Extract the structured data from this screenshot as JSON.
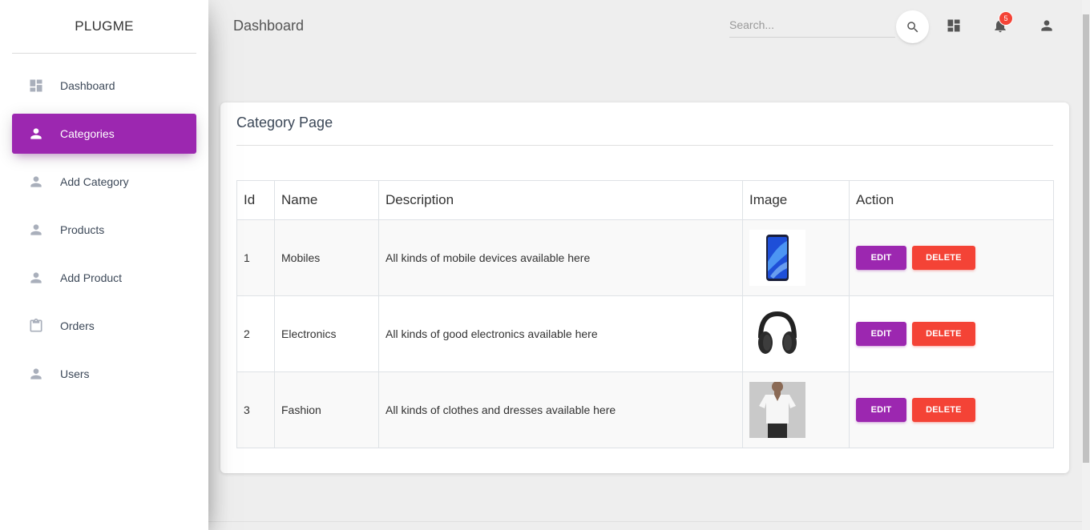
{
  "brand": "PLUGME",
  "sidebar": {
    "items": [
      {
        "label": "Dashboard",
        "icon": "dashboard-icon",
        "active": false
      },
      {
        "label": "Categories",
        "icon": "person-icon",
        "active": true
      },
      {
        "label": "Add Category",
        "icon": "person-icon",
        "active": false
      },
      {
        "label": "Products",
        "icon": "person-icon",
        "active": false
      },
      {
        "label": "Add Product",
        "icon": "person-icon",
        "active": false
      },
      {
        "label": "Orders",
        "icon": "clipboard-icon",
        "active": false
      },
      {
        "label": "Users",
        "icon": "person-icon",
        "active": false
      }
    ]
  },
  "header": {
    "title": "Dashboard",
    "search_placeholder": "Search...",
    "notification_count": "5",
    "icons": [
      "search-icon",
      "dashboard-icon",
      "bell-icon",
      "person-icon"
    ]
  },
  "card": {
    "title": "Category Page",
    "columns": [
      "Id",
      "Name",
      "Description",
      "Image",
      "Action"
    ],
    "rows": [
      {
        "id": "1",
        "name": "Mobiles",
        "description": "All kinds of mobile devices available here",
        "image": "smartphone"
      },
      {
        "id": "2",
        "name": "Electronics",
        "description": "All kinds of good electronics available here",
        "image": "headphones"
      },
      {
        "id": "3",
        "name": "Fashion",
        "description": "All kinds of clothes and dresses available here",
        "image": "t-shirt model"
      }
    ],
    "edit_label": "EDIT",
    "delete_label": "DELETE"
  },
  "colors": {
    "primary": "#9c27b0",
    "danger": "#f44336",
    "background": "#eeeeee"
  }
}
